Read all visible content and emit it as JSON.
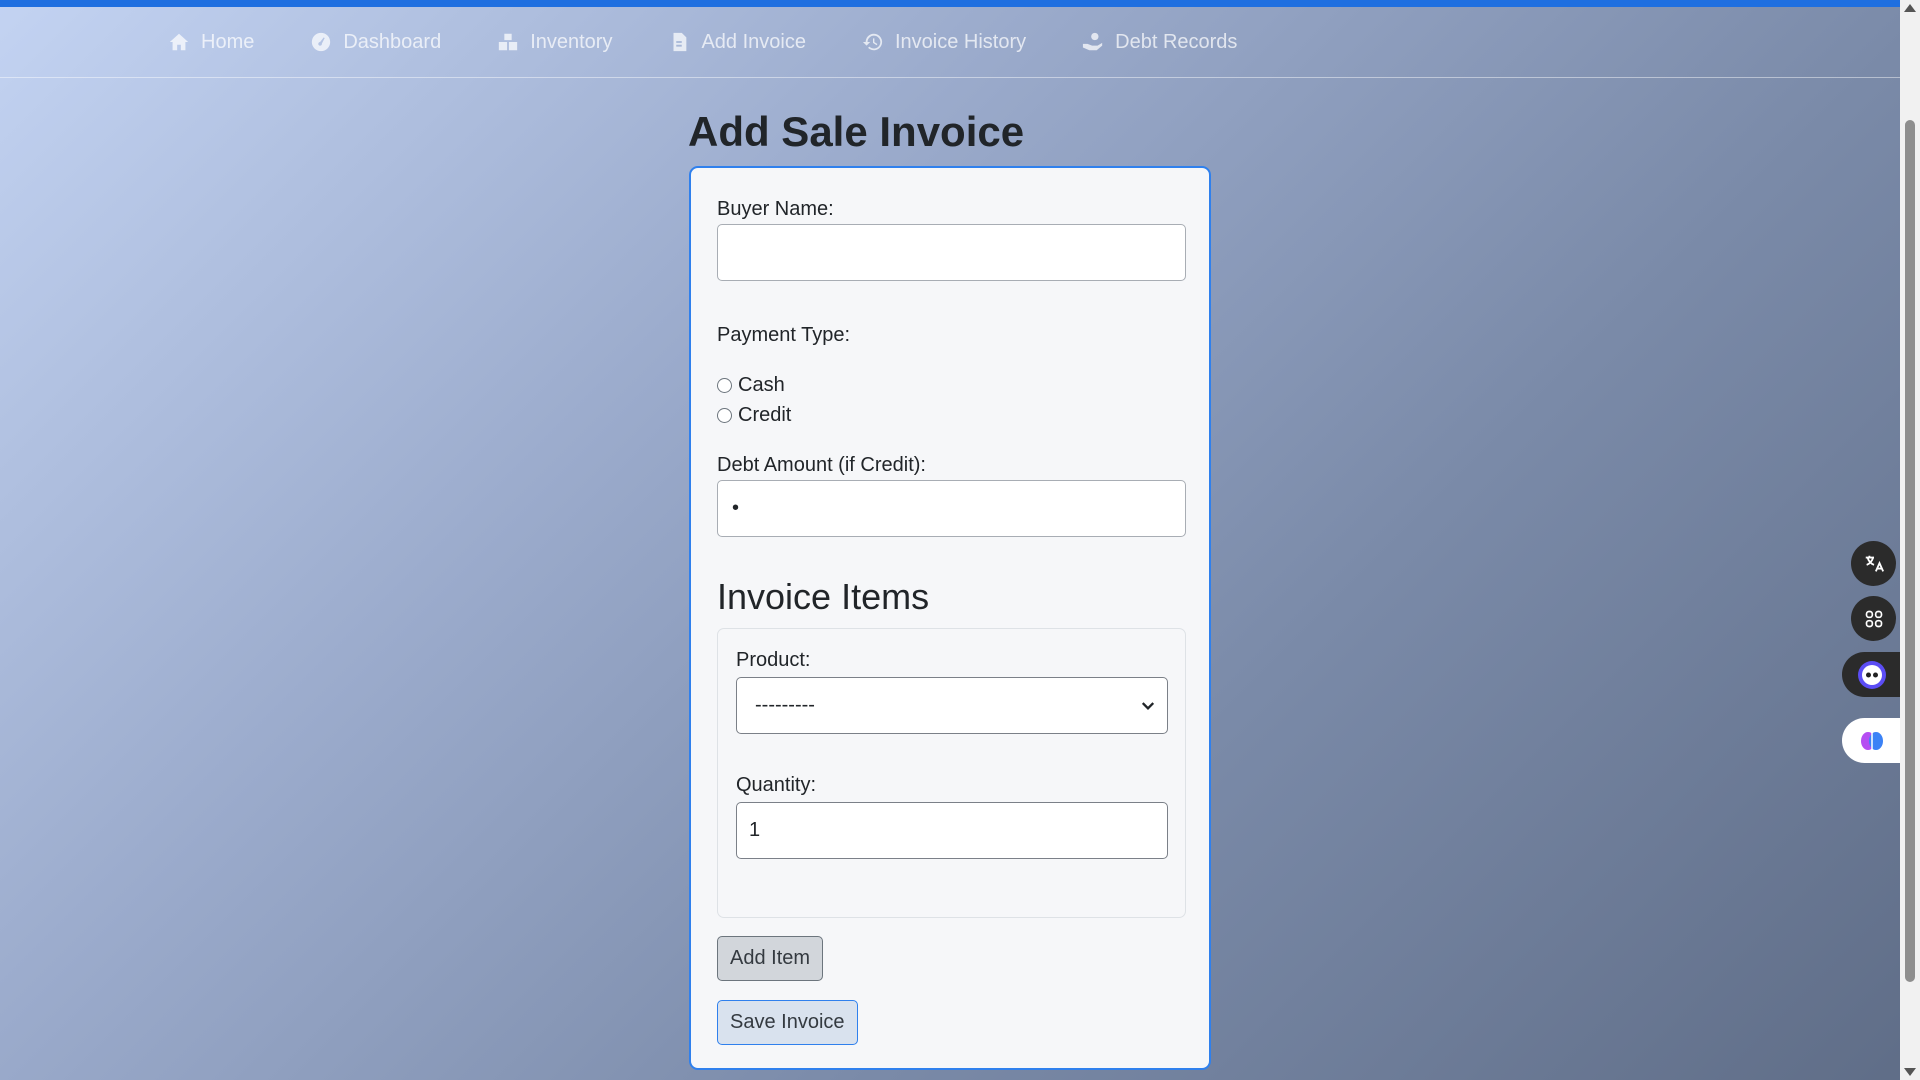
{
  "nav": {
    "items": [
      {
        "label": "Home",
        "icon": "home-icon"
      },
      {
        "label": "Dashboard",
        "icon": "gauge-icon"
      },
      {
        "label": "Inventory",
        "icon": "boxes-icon"
      },
      {
        "label": "Add Invoice",
        "icon": "file-invoice-icon"
      },
      {
        "label": "Invoice History",
        "icon": "history-icon"
      },
      {
        "label": "Debt Records",
        "icon": "hand-coin-icon"
      }
    ]
  },
  "page": {
    "title": "Add Sale Invoice"
  },
  "form": {
    "buyer_label": "Buyer Name:",
    "buyer_value": "",
    "payment_label": "Payment Type:",
    "payment_options": [
      "Cash",
      "Credit"
    ],
    "debt_label": "Debt Amount (if Credit):",
    "debt_value": "•",
    "items_title": "Invoice Items",
    "product_label": "Product:",
    "product_selected": "---------",
    "quantity_label": "Quantity:",
    "quantity_value": "1",
    "add_item_label": "Add Item",
    "save_label": "Save Invoice"
  },
  "colors": {
    "accent": "#1f6fe0",
    "card_border": "#2f80ed"
  }
}
